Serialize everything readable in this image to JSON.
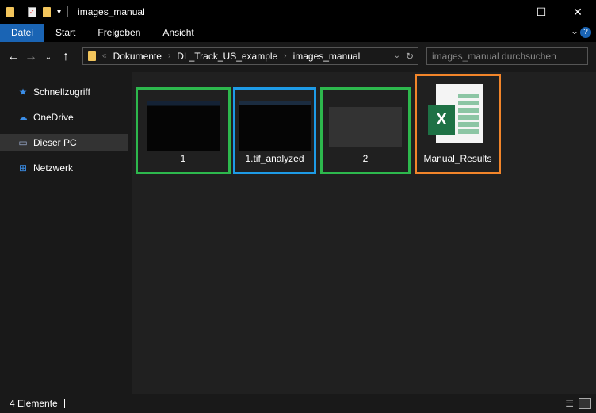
{
  "window": {
    "title": "images_manual",
    "min": "–",
    "max": "☐",
    "close": "✕"
  },
  "ribbon": {
    "tabs": [
      "Datei",
      "Start",
      "Freigeben",
      "Ansicht"
    ],
    "expand": "⌄",
    "help": "?"
  },
  "address": {
    "crumbs": [
      "Dokumente",
      "DL_Track_US_example",
      "images_manual"
    ],
    "overflow": "«",
    "search_placeholder": "images_manual durchsuchen"
  },
  "sidebar": {
    "items": [
      {
        "label": "Schnellzugriff",
        "icon": "★",
        "color": "#3b8ee8"
      },
      {
        "label": "OneDrive",
        "icon": "☁",
        "color": "#3b8ee8"
      },
      {
        "label": "Dieser PC",
        "icon": "▭",
        "color": "#9ac"
      },
      {
        "label": "Netzwerk",
        "icon": "⊞",
        "color": "#3b8ee8"
      }
    ]
  },
  "files": [
    {
      "name": "1",
      "border": "#2db84d"
    },
    {
      "name": "1.tif_analyzed",
      "border": "#1e9be6"
    },
    {
      "name": "2",
      "border": "#2db84d"
    },
    {
      "name": "Manual_Results",
      "border": "#f2852a"
    }
  ],
  "status": {
    "count": "4 Elemente"
  }
}
